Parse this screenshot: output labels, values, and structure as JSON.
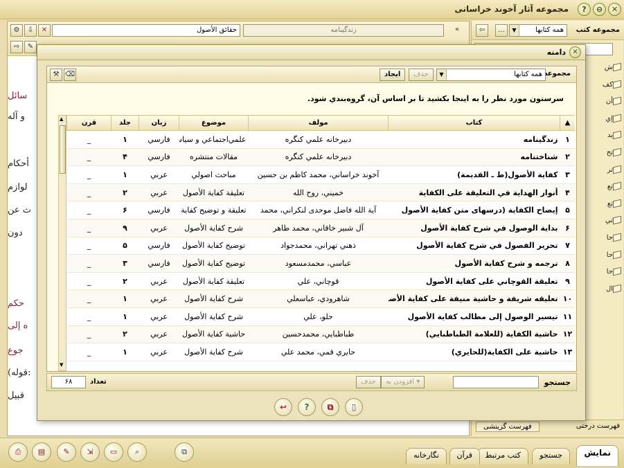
{
  "app": {
    "title": "مجموعه آثار آخوند خراسانی"
  },
  "right_panel": {
    "label": "مجموعه کتب",
    "collection_value": "همه کتابها",
    "tree_items": [
      "ش",
      "کف",
      "أن",
      "إي",
      "بد",
      "تح",
      "تر",
      "تع",
      "تع",
      "تي",
      "حا",
      "حا",
      "حا",
      "ال"
    ],
    "tab_tree": "فهرست درختی",
    "tab_selected": "فهرست گزینشی"
  },
  "left_panel": {
    "book_field": "حقائق الأصول",
    "biography_field": "زندگینامه",
    "text_lines": [
      "سائل",
      "و آله",
      "أحكام",
      "لوازم",
      "ث عن",
      "دون",
      "حكم",
      "ه إلى",
      "جوع",
      "(قوله:",
      "قبيل"
    ]
  },
  "dialog": {
    "title": "دامنه",
    "collection_label": "مجموعه کتب",
    "collection_value": "همه کتابها",
    "delete_label": "حذف",
    "create_label": "ایجاد",
    "instruction": "سرستون مورد نظر را به اینجا بکشید تا بر اساس آن، گروه‌بندي شود.",
    "columns": {
      "index": "",
      "book": "کتاب",
      "author": "مولف",
      "subject": "موضوع",
      "language": "زبان",
      "volume": "جلد",
      "century": "قرن"
    },
    "rows": [
      {
        "n": "۱",
        "book": "زندگینامه",
        "author": "دبیرخانه علمي کنگره",
        "subject": "علمي‌اجتماعي و سياسي",
        "lang": "فارسي",
        "vol": "۱",
        "century": "_"
      },
      {
        "n": "۲",
        "book": "شناختنامه",
        "author": "دبیرخانه علمي کنگره",
        "subject": "مقالات منتشره",
        "lang": "فارسي",
        "vol": "۴",
        "century": "_"
      },
      {
        "n": "۳",
        "book": "كفاية الأصول(ط ـ القديمة)",
        "author": "آخوند خراساني، محمد كاظم بن حسين",
        "subject": "مباحث اصولي",
        "lang": "عربي",
        "vol": "۱",
        "century": "_"
      },
      {
        "n": "۴",
        "book": "أنوار الهداية في التعليقة على الكفاية",
        "author": "خميني، روح الله",
        "subject": "تعليقة كفاية الأصول",
        "lang": "عربي",
        "vol": "۲",
        "century": "_"
      },
      {
        "n": "۵",
        "book": "إيضاح الكفاية (درسهاى متن كفاية الأصول",
        "author": "آية الله فاضل موحدى لنكراني، محمد",
        "subject": "تعليقة و توضيح كفاية",
        "lang": "فارسي",
        "vol": "۶",
        "century": "_"
      },
      {
        "n": "۶",
        "book": "بداية الوصول في شرح كفاية الأصول",
        "author": "آل شبير خاقاني، محمد طاهر",
        "subject": "شرح كفاية الأصول",
        "lang": "عربي",
        "vol": "۹",
        "century": "_"
      },
      {
        "n": "۷",
        "book": "تحرير الفصول في شرح كفاية الأصول",
        "author": "ذهني تهراني، محمدجواد",
        "subject": "توضيح كفاية الأصول",
        "lang": "فارسي",
        "vol": "۵",
        "century": "_"
      },
      {
        "n": "۸",
        "book": "ترجمه و شرح كفاية الأصول",
        "author": "عباسي، محمدمسعود",
        "subject": "توضيح كفاية الأصول",
        "lang": "فارسي",
        "vol": "۳",
        "century": "_"
      },
      {
        "n": "۹",
        "book": "تعليقة القوچاني على كفاية الأصول",
        "author": "قوچاني، علي",
        "subject": "تعليقة كفاية الأصول",
        "lang": "عربي",
        "vol": "۲",
        "century": "_"
      },
      {
        "n": "۱۰",
        "book": "تعليقه شريفة و حاشية منيفة على كفاية الأصول",
        "author": "شاهرودي، عباسعلي",
        "subject": "شرح كفاية الأصول",
        "lang": "عربي",
        "vol": "۱",
        "century": "_"
      },
      {
        "n": "۱۱",
        "book": "تيسير الوصول إلى مطالب كفاية الأصول",
        "author": "حلو، علي",
        "subject": "شرح كفاية الأصول",
        "lang": "عربي",
        "vol": "۱",
        "century": "_"
      },
      {
        "n": "۱۲",
        "book": "حاشية الكفاية (للعلامة الطباطبايي)",
        "author": "طباطبايي، محمدحسين",
        "subject": "حاشية كفاية الأصول",
        "lang": "عربي",
        "vol": "۲",
        "century": "_"
      },
      {
        "n": "۱۳",
        "book": "حاشية على الكفاية(للحايري)",
        "author": "حايري قمي، محمد علي",
        "subject": "شرح كفاية الأصول",
        "lang": "عربي",
        "vol": "۱",
        "century": "_"
      }
    ],
    "search_label": "جستجو",
    "search_value": "",
    "add_label": "افزودن به",
    "remove_label": "حذف",
    "count_label": "تعداد",
    "count_value": "۶۸"
  },
  "bottom_tabs": [
    "نمایش",
    "جستجو",
    "کتب مرتبط",
    "قرآن",
    "نگارخانه"
  ]
}
